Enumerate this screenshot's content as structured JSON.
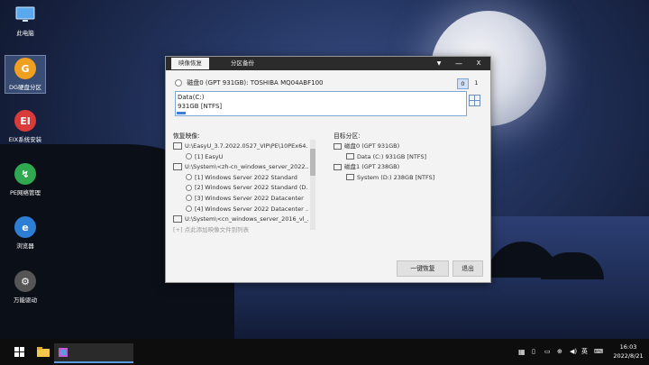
{
  "desktop": {
    "icons": [
      {
        "label": "此电脑"
      },
      {
        "label": "DG硬盘分区"
      },
      {
        "label": "EIX系统安装"
      },
      {
        "label": "PE网络管理"
      },
      {
        "label": "浏览器"
      },
      {
        "label": "万能驱动"
      }
    ]
  },
  "dialog": {
    "tabs": [
      {
        "label": "映像恢复"
      },
      {
        "label": "分区备份"
      }
    ],
    "controls": {
      "dropdown": "▼",
      "minimize": "—",
      "close": "X"
    },
    "disk_label": "磁盘0 (GPT 931GB): TOSHIBA MQ04ABF100",
    "pages": [
      "0",
      "1"
    ],
    "partition": {
      "name": "Data(C:)",
      "size": "931GB [NTFS]",
      "fill_fraction": 0.03
    },
    "restore_title": "恢复映像:",
    "images": [
      {
        "label": "U:\\EasyU_3.7.2022.0527_VIP\\PE\\10PEx64...",
        "level": 0
      },
      {
        "label": "[1] EasyU",
        "level": 1
      },
      {
        "label": "U:\\System\\<zh-cn_windows_server_2022...",
        "level": 0
      },
      {
        "label": "[1] Windows Server 2022 Standard",
        "level": 1
      },
      {
        "label": "[2] Windows Server 2022 Standard (D...",
        "level": 1
      },
      {
        "label": "[3] Windows Server 2022 Datacenter",
        "level": 1
      },
      {
        "label": "[4] Windows Server 2022 Datacenter ...",
        "level": 1
      },
      {
        "label": "U:\\System\\<cn_windows_server_2016_vl_...",
        "level": 0
      }
    ],
    "add_hint": "[+] 点此添加映像文件到列表",
    "target_title": "目标分区:",
    "targets": [
      {
        "label": "磁盘0 (GPT 931GB)",
        "level": 0
      },
      {
        "label": "Data (C:) 931GB [NTFS]",
        "level": 1
      },
      {
        "label": "磁盘1 (GPT 238GB)",
        "level": 0
      },
      {
        "label": "System (D:) 238GB [NTFS]",
        "level": 1
      }
    ],
    "buttons": {
      "restore": "一键恢复",
      "exit": "退出"
    }
  },
  "taskbar": {
    "tray_lang": "英",
    "time": "16:03",
    "date": "2022/8/21"
  },
  "colors": {
    "accent": "#3b7fd8",
    "titlebar": "#2b2b2b"
  }
}
